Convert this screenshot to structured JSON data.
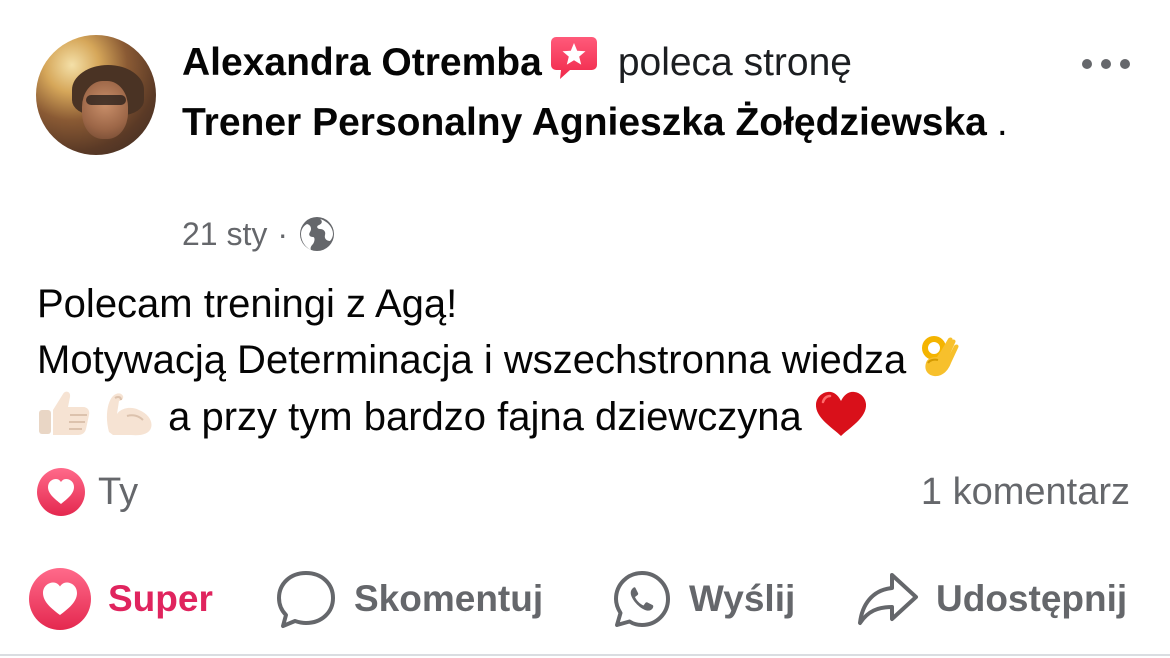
{
  "post": {
    "author": "Alexandra Otremba",
    "action": "poleca stronę",
    "page": "Trener Personalny Agnieszka Żołędziewska",
    "period": ".",
    "date": "21 sty",
    "separator": "·",
    "privacy_icon": "globe-icon",
    "badge_icon": "recommendation-icon",
    "text_line1": "Polecam treningi z Agą!",
    "text_line2": "Motywacją Determinacja i wszechstronna wiedza",
    "text_line3": "a przy tym bardzo fajna dziewczyna",
    "emojis": [
      "ok-hand-emoji",
      "thumbs-up-emoji",
      "flexed-biceps-emoji",
      "red-heart-emoji"
    ]
  },
  "reactions": {
    "icon": "love-reaction-icon",
    "label": "Ty"
  },
  "comments": {
    "count_label": "1 komentarz"
  },
  "actions": {
    "super": "Super",
    "comment": "Skomentuj",
    "send": "Wyślij",
    "share": "Udostępnij"
  },
  "colors": {
    "accent_red": "#e0245e",
    "muted": "#65676b",
    "text": "#050505"
  }
}
